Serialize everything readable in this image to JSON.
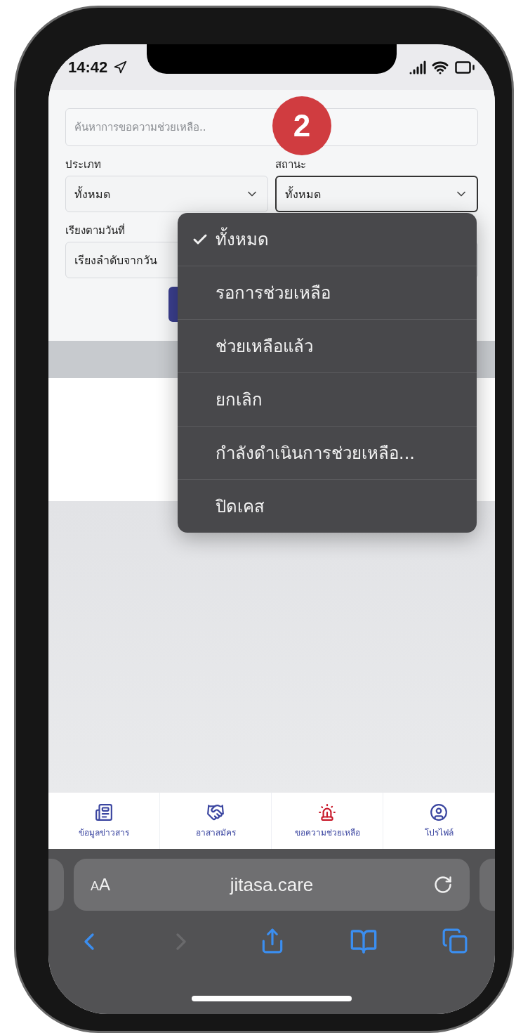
{
  "status_bar": {
    "time": "14:42"
  },
  "badge": "2",
  "search": {
    "placeholder": "ค้นหาการขอความช่วยเหลือ.."
  },
  "filters": [
    {
      "label": "ประเภท",
      "value": "ทั้งหมด",
      "focused": false
    },
    {
      "label": "สถานะ",
      "value": "ทั้งหมด",
      "focused": true
    }
  ],
  "sort": {
    "label": "เรียงตามวันที่",
    "value": "เรียงลำดับจากวัน"
  },
  "status_menu": [
    {
      "label": "ทั้งหมด",
      "selected": true
    },
    {
      "label": "รอการช่วยเหลือ",
      "selected": false
    },
    {
      "label": "ช่วยเหลือแล้ว",
      "selected": false
    },
    {
      "label": "ยกเลิก",
      "selected": false
    },
    {
      "label": "กำลังดำเนินการช่วยเหลือ...",
      "selected": false
    },
    {
      "label": "ปิดเคส",
      "selected": false
    }
  ],
  "bottom_nav": [
    {
      "kind": "news",
      "label": "ข้อมูลข่าวสาร"
    },
    {
      "kind": "volunteer",
      "label": "อาสาสมัคร"
    },
    {
      "kind": "help",
      "label": "ขอความช่วยเหลือ"
    },
    {
      "kind": "profile",
      "label": "โปรไฟล์"
    }
  ],
  "browser": {
    "text_size": "AA",
    "url": "jitasa.care"
  }
}
